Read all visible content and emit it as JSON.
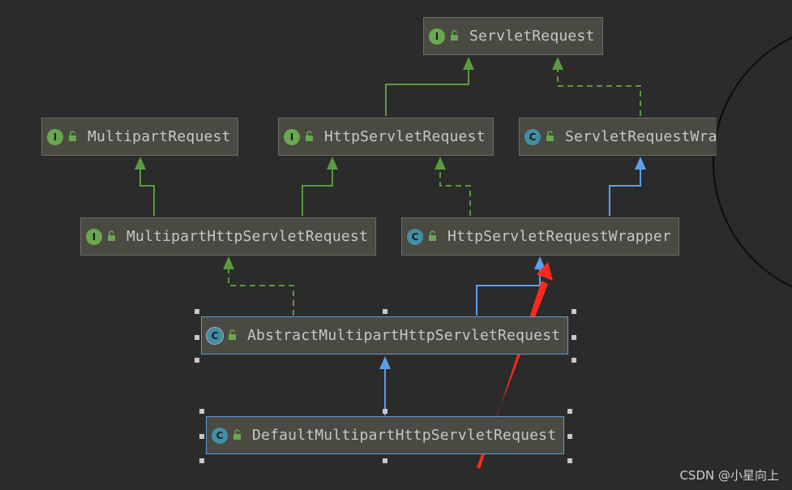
{
  "nodes": {
    "servlet_request": {
      "label": "ServletRequest",
      "kind": "interface",
      "badge": "I"
    },
    "multipart_request": {
      "label": "MultipartRequest",
      "kind": "interface",
      "badge": "I"
    },
    "http_servlet_request": {
      "label": "HttpServletRequest",
      "kind": "interface",
      "badge": "I"
    },
    "servlet_request_wrapper": {
      "label": "ServletRequestWra",
      "kind": "class",
      "badge": "C"
    },
    "multipart_http_servlet_request": {
      "label": "MultipartHttpServletRequest",
      "kind": "interface",
      "badge": "I"
    },
    "http_servlet_request_wrapper": {
      "label": "HttpServletRequestWrapper",
      "kind": "class",
      "badge": "C"
    },
    "abstract_multipart_http_servlet_request": {
      "label": "AbstractMultipartHttpServletRequest",
      "kind": "abstract-class",
      "badge": "C"
    },
    "default_multipart_http_servlet_request": {
      "label": "DefaultMultipartHttpServletRequest",
      "kind": "class",
      "badge": "C"
    }
  },
  "colors": {
    "background": "#2b2b2b",
    "node_fill": "#4a4942",
    "interface_badge": "#6aa84f",
    "class_badge": "#3f8fa6",
    "extends_interface_edge": "#5b9a3f",
    "extends_class_edge": "#5aa0f0",
    "annotation_arrow": "#ff2a1f",
    "selection_border": "#5a9bd8"
  },
  "watermark": "CSDN @小星向上"
}
